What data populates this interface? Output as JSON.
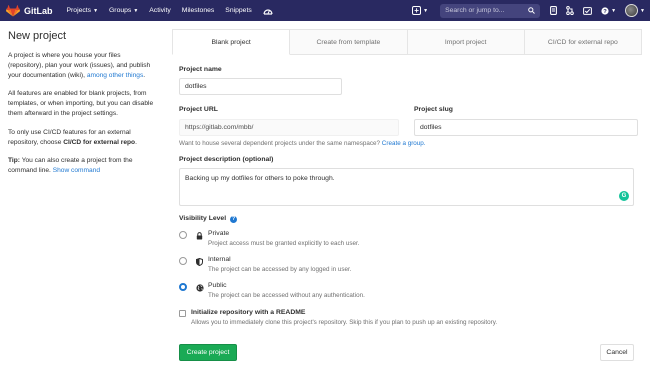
{
  "navbar": {
    "brand": "GitLab",
    "links": [
      {
        "label": "Projects",
        "dropdown": true
      },
      {
        "label": "Groups",
        "dropdown": true
      },
      {
        "label": "Activity",
        "dropdown": false
      },
      {
        "label": "Milestones",
        "dropdown": false
      },
      {
        "label": "Snippets",
        "dropdown": false
      }
    ],
    "search_placeholder": "Search or jump to...",
    "colors": {
      "navbar_bg": "#292961",
      "search_bg": "#44447d",
      "logo_orange": "#fc6d26"
    }
  },
  "sidebar": {
    "title": "New project",
    "intro": "A project is where you house your files (repository), plan your work (issues), and publish your documentation (wiki),",
    "intro_link": "among other things",
    "intro_end": ".",
    "features": "All features are enabled for blank projects, from templates, or when importing, but you can disable them afterward in the project settings.",
    "cicd_prefix": "To only use CI/CD features for an external repository, choose",
    "cicd_bold": "CI/CD for external repo",
    "cicd_end": ".",
    "tip_label": "Tip:",
    "tip_text": "You can also create a project from the command line.",
    "tip_link": "Show command"
  },
  "tabs": [
    "Blank project",
    "Create from template",
    "Import project",
    "CI/CD for external repo"
  ],
  "form": {
    "project_name_label": "Project name",
    "project_name_value": "dotfiles",
    "project_url_label": "Project URL",
    "project_url_value": "https://gitlab.com/mbb/",
    "project_slug_label": "Project slug",
    "project_slug_value": "dotfiles",
    "namespace_help": "Want to house several dependent projects under the same namespace?",
    "namespace_link": "Create a group.",
    "description_label": "Project description (optional)",
    "description_value": "Backing up my dotfiles for others to poke through.",
    "visibility_label": "Visibility Level",
    "visibility": [
      {
        "title": "Private",
        "desc": "Project access must be granted explicitly to each user.",
        "icon": "lock-icon",
        "checked": false
      },
      {
        "title": "Internal",
        "desc": "The project can be accessed by any logged in user.",
        "icon": "shield-icon",
        "checked": false
      },
      {
        "title": "Public",
        "desc": "The project can be accessed without any authentication.",
        "icon": "globe-icon",
        "checked": true
      }
    ],
    "readme_label": "Initialize repository with a README",
    "readme_desc": "Allows you to immediately clone this project's repository. Skip this if you plan to push up an existing repository.",
    "create_button": "Create project",
    "cancel_button": "Cancel",
    "colors": {
      "accent": "#1f78d1",
      "create_green": "#1aaa55"
    }
  }
}
